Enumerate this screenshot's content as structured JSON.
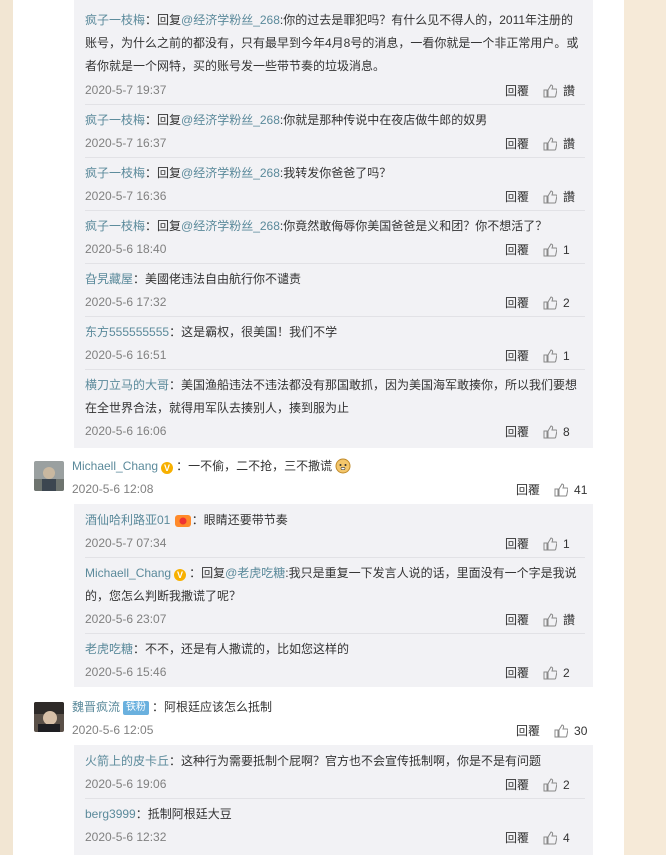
{
  "common": {
    "reply_label": "回覆",
    "like_empty": "讚"
  },
  "top_replies": [
    {
      "name": "疯子一枝梅",
      "prefix": "：回复",
      "at": "@经济学粉丝_268",
      "text_line1": ":你的过去是罪犯吗？有什么见不得人的，2011年注册的",
      "text_line2": "账号，为什么之前的都没有，只有最早到今年4月8号的消息，一看你就是一个非正常用户。或",
      "text_line3": "者你就是一个网特，买的账号发一些带节奏的垃圾消息。",
      "time": "2020-5-7 19:37",
      "likes": "讚"
    },
    {
      "name": "疯子一枝梅",
      "prefix": "：回复",
      "at": "@经济学粉丝_268",
      "text_line1": ":你就是那种传说中在夜店做牛郎的奴男",
      "time": "2020-5-7 16:37",
      "likes": "讚"
    },
    {
      "name": "疯子一枝梅",
      "prefix": "：回复",
      "at": "@经济学粉丝_268",
      "text_line1": ":我转发你爸爸了吗？",
      "time": "2020-5-7 16:36",
      "likes": "讚"
    },
    {
      "name": "疯子一枝梅",
      "prefix": "：回复",
      "at": "@经济学粉丝_268",
      "text_line1": ":你竟然敢侮辱你美国爸爸是义和团？你不想活了？",
      "time": "2020-5-6 18:40",
      "likes": "1"
    },
    {
      "name": "旮旯藏屋",
      "text_line1": "：美國佬违法自由航行你不谴责",
      "time": "2020-5-6 17:32",
      "likes": "2"
    },
    {
      "name": "东方555555555",
      "text_line1": "：这是霸权，很美国！我们不学",
      "time": "2020-5-6 16:51",
      "likes": "1"
    },
    {
      "name": "横刀立马的大哥",
      "text_line1": "：美国渔船违法不违法都没有那国敢抓，因为美国海军敢揍你，所以我们要想",
      "text_line2": "在全世界合法，就得用军队去揍别人，揍到服为止",
      "time": "2020-5-6 16:06",
      "likes": "8"
    }
  ],
  "comment1": {
    "name": "Michaell_Chang",
    "text": "：一不偷，二不抢，三不撒谎",
    "time": "2020-5-6 12:08",
    "likes": "41"
  },
  "c1_replies": [
    {
      "name": "酒仙哈利路亚01",
      "text_line1": "：眼睛还要带节奏",
      "time": "2020-5-7 07:34",
      "likes": "1"
    },
    {
      "name": "Michaell_Chang",
      "prefix": "：回复",
      "at": "@老虎吃糖",
      "text_line1": ":我只是重复一下发言人说的话，里面没有一个字是我说",
      "text_line2": "的，您怎么判断我撒谎了呢？",
      "time": "2020-5-6 23:07",
      "likes": "讚"
    },
    {
      "name": "老虎吃糖",
      "text_line1": "：不不，还是有人撒谎的，比如您这样的",
      "time": "2020-5-6 15:46",
      "likes": "2"
    }
  ],
  "comment2": {
    "name": "魏晋疯流",
    "badge": "铁粉",
    "text": "：阿根廷应该怎么抵制",
    "time": "2020-5-6 12:05",
    "likes": "30"
  },
  "c2_replies": [
    {
      "name": "火箭上的皮卡丘",
      "text_line1": "：这种行为需要抵制个屁啊？官方也不会宣传抵制啊，你是不是有问题",
      "time": "2020-5-6 19:06",
      "likes": "2"
    },
    {
      "name": "berg3999",
      "text_line1": "：抵制阿根廷大豆",
      "time": "2020-5-6 12:32",
      "likes": "4"
    }
  ]
}
